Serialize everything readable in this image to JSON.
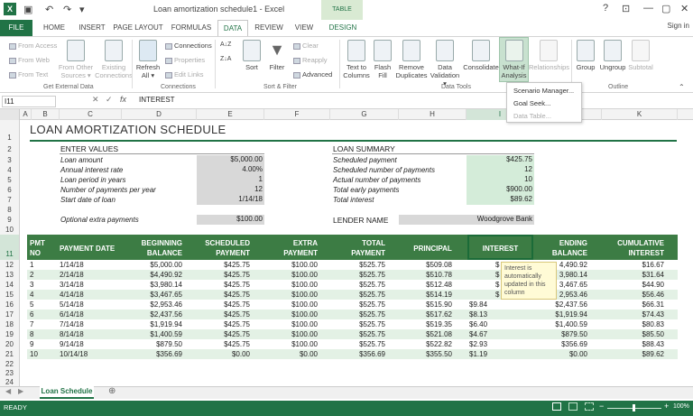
{
  "titlebar": {
    "doc_title": "Loan amortization schedule1 - Excel",
    "table_tools": "TABLE TOOLS",
    "help": "?",
    "minimize": "—",
    "restore": "▢",
    "close": "✕"
  },
  "tabs": {
    "file": "FILE",
    "home": "HOME",
    "insert": "INSERT",
    "page_layout": "PAGE LAYOUT",
    "formulas": "FORMULAS",
    "data": "DATA",
    "review": "REVIEW",
    "view": "VIEW",
    "design": "DESIGN",
    "sign_in": "Sign in"
  },
  "ribbon": {
    "from_access": "From Access",
    "from_web": "From Web",
    "from_text": "From Text",
    "from_other_1": "From Other",
    "from_other_2": "Sources ▾",
    "existing_1": "Existing",
    "existing_2": "Connections",
    "group_external": "Get External Data",
    "refresh_1": "Refresh",
    "refresh_2": "All ▾",
    "connections": "Connections",
    "properties": "Properties",
    "edit_links": "Edit Links",
    "group_connections": "Connections",
    "sort": "Sort",
    "filter": "Filter",
    "clear": "Clear",
    "reapply": "Reapply",
    "advanced": "Advanced",
    "group_sort": "Sort & Filter",
    "text_to_1": "Text to",
    "text_to_2": "Columns",
    "flash_1": "Flash",
    "flash_2": "Fill",
    "remove_1": "Remove",
    "remove_2": "Duplicates",
    "validation_1": "Data",
    "validation_2": "Validation ▾",
    "consolidate": "Consolidate",
    "whatif_1": "What-If",
    "whatif_2": "Analysis ▾",
    "relationships": "Relationships",
    "group_tools": "Data Tools",
    "group": "Group",
    "ungroup": "Ungroup",
    "subtotal": "Subtotal",
    "group_outline": "Outline"
  },
  "whatif_menu": {
    "scenario": "Scenario Manager...",
    "goal_seek": "Goal Seek...",
    "data_table": "Data Table..."
  },
  "formula_bar": {
    "name_box": "I11",
    "fx": "fx",
    "content": "INTEREST"
  },
  "columns": [
    "A",
    "B",
    "C",
    "D",
    "E",
    "F",
    "G",
    "H",
    "I",
    "J",
    "K"
  ],
  "rows": [
    "1",
    "2",
    "3",
    "4",
    "5",
    "6",
    "7",
    "8",
    "9",
    "10",
    "11",
    "12",
    "13",
    "14",
    "15",
    "16",
    "17",
    "18",
    "19",
    "20",
    "21",
    "22",
    "23",
    "24"
  ],
  "sheet_title": "LOAN AMORTIZATION SCHEDULE",
  "enter_values": {
    "heading": "ENTER VALUES",
    "items": [
      {
        "label": "Loan amount",
        "value": "$5,000.00"
      },
      {
        "label": "Annual interest rate",
        "value": "4.00%"
      },
      {
        "label": "Loan period in years",
        "value": "1"
      },
      {
        "label": "Number of payments per year",
        "value": "12"
      },
      {
        "label": "Start date of loan",
        "value": "1/14/18"
      }
    ],
    "extra_label": "Optional extra payments",
    "extra_value": "$100.00"
  },
  "loan_summary": {
    "heading": "LOAN SUMMARY",
    "items": [
      {
        "label": "Scheduled payment",
        "value": "$425.75"
      },
      {
        "label": "Scheduled number of payments",
        "value": "12"
      },
      {
        "label": "Actual number of payments",
        "value": "10"
      },
      {
        "label": "Total early payments",
        "value": "$900.00"
      },
      {
        "label": "Total interest",
        "value": "$89.62"
      }
    ],
    "lender_label": "LENDER NAME",
    "lender_value": "Woodgrove Bank"
  },
  "table": {
    "headers": [
      [
        "PMT",
        "NO"
      ],
      [
        "PAYMENT DATE",
        ""
      ],
      [
        "BEGINNING",
        "BALANCE"
      ],
      [
        "SCHEDULED",
        "PAYMENT"
      ],
      [
        "EXTRA",
        "PAYMENT"
      ],
      [
        "TOTAL",
        "PAYMENT"
      ],
      [
        "PRINCIPAL",
        ""
      ],
      [
        "INTEREST",
        ""
      ],
      [
        "ENDING",
        "BALANCE"
      ],
      [
        "CUMULATIVE",
        "INTEREST"
      ]
    ],
    "rows": [
      [
        "1",
        "1/14/18",
        "$5,000.00",
        "$425.75",
        "$100.00",
        "$525.75",
        "$509.08",
        "$",
        "4,490.92",
        "$16.67"
      ],
      [
        "2",
        "2/14/18",
        "$4,490.92",
        "$425.75",
        "$100.00",
        "$525.75",
        "$510.78",
        "$",
        "3,980.14",
        "$31.64"
      ],
      [
        "3",
        "3/14/18",
        "$3,980.14",
        "$425.75",
        "$100.00",
        "$525.75",
        "$512.48",
        "$",
        "3,467.65",
        "$44.90"
      ],
      [
        "4",
        "4/14/18",
        "$3,467.65",
        "$425.75",
        "$100.00",
        "$525.75",
        "$514.19",
        "$",
        "2,953.46",
        "$56.46"
      ],
      [
        "5",
        "5/14/18",
        "$2,953.46",
        "$425.75",
        "$100.00",
        "$525.75",
        "$515.90",
        "$9.84",
        "$2,437.56",
        "$66.31"
      ],
      [
        "6",
        "6/14/18",
        "$2,437.56",
        "$425.75",
        "$100.00",
        "$525.75",
        "$517.62",
        "$8.13",
        "$1,919.94",
        "$74.43"
      ],
      [
        "7",
        "7/14/18",
        "$1,919.94",
        "$425.75",
        "$100.00",
        "$525.75",
        "$519.35",
        "$6.40",
        "$1,400.59",
        "$80.83"
      ],
      [
        "8",
        "8/14/18",
        "$1,400.59",
        "$425.75",
        "$100.00",
        "$525.75",
        "$521.08",
        "$4.67",
        "$879.50",
        "$85.50"
      ],
      [
        "9",
        "9/14/18",
        "$879.50",
        "$425.75",
        "$100.00",
        "$525.75",
        "$522.82",
        "$2.93",
        "$356.69",
        "$88.43"
      ],
      [
        "10",
        "10/14/18",
        "$356.69",
        "$0.00",
        "$0.00",
        "$356.69",
        "$355.50",
        "$1.19",
        "$0.00",
        "$89.62"
      ]
    ]
  },
  "tooltip": "Interest is automatically updated in this column",
  "sheet_tab": "Loan Schedule",
  "add_sheet": "⊕",
  "status": {
    "ready": "READY",
    "zoom": "100%",
    "minus": "−",
    "plus": "+"
  }
}
